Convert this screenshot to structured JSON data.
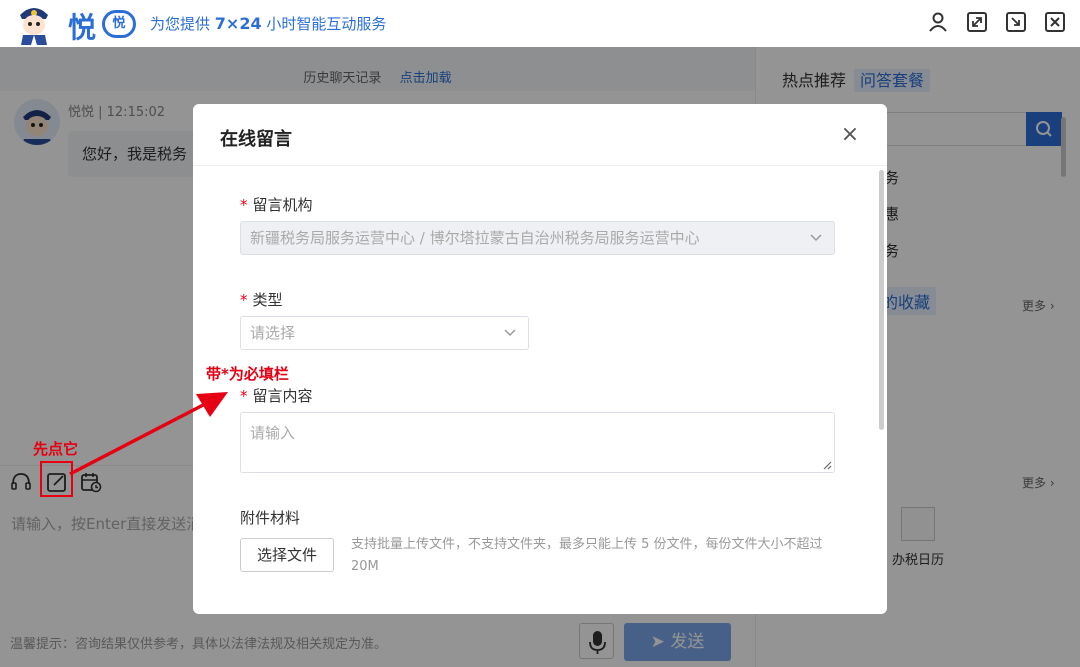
{
  "header": {
    "logo_char": "悦",
    "logo_badge": "悦",
    "tagline_prefix": "为您提供 ",
    "tagline_bold": "7×24",
    "tagline_suffix": " 小时智能互动服务",
    "icons": [
      "user-icon",
      "expand-icon",
      "minimize-icon",
      "close-icon"
    ]
  },
  "chat": {
    "history_label": "历史聊天记录",
    "history_link": "点击加载",
    "bot_name_time": "悦悦 | 12:15:02",
    "bot_message": "您好，我是税务"
  },
  "right_panel": {
    "tab_hot": "热点推荐",
    "tab_qa": "问答套餐",
    "items": [
      "务",
      "惠",
      "务"
    ],
    "favorites_label": "的收藏",
    "more_label": "更多 ›",
    "more_label_2": "更多 ›",
    "calendar_label": "办税日历"
  },
  "composer": {
    "input_placeholder": "请输入，按Enter直接发送消",
    "footer_tip": "温馨提示：咨询结果仅供参考，具体以法律法规及相关规定为准。",
    "send_label": "发送",
    "send_glyph": "➤"
  },
  "annotations": {
    "click_first": "先点它",
    "required_note": "带*为必填栏"
  },
  "modal": {
    "title": "在线留言",
    "close_glyph": "×",
    "org_label": "留言机构",
    "org_value": "新疆税务局服务运营中心 / 博尔塔拉蒙古自治州税务局服务运营中心",
    "type_label": "类型",
    "type_placeholder": "请选择",
    "content_label": "留言内容",
    "content_placeholder": "请输入",
    "attach_label": "附件材料",
    "file_button": "选择文件",
    "file_hint": "支持批量上传文件，不支持文件夹，最多只能上传 5 份文件，每份文件大小不超过 20M",
    "required_mark": "*"
  },
  "colors": {
    "brand": "#2b6fd6",
    "annotation_red": "#e60012",
    "send_disabled": "#7ba6ea"
  }
}
